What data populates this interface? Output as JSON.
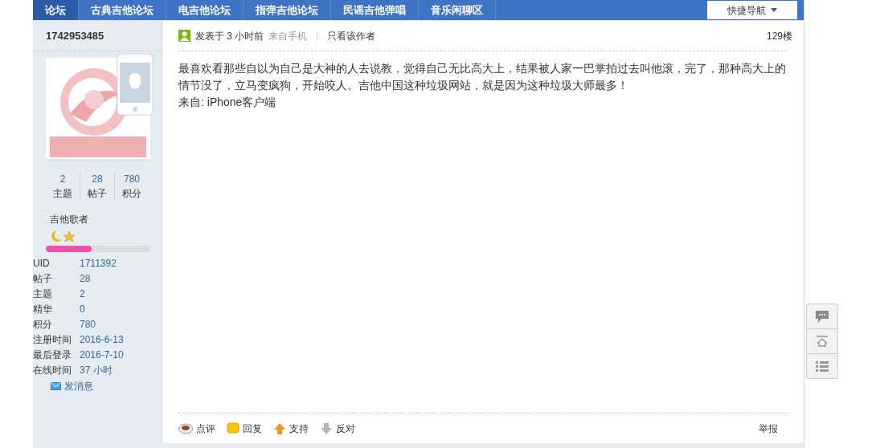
{
  "nav": {
    "tabs": [
      {
        "label": "论坛",
        "selected": true
      },
      {
        "label": "古典吉他论坛",
        "selected": false
      },
      {
        "label": "电吉他论坛",
        "selected": false
      },
      {
        "label": "指弹吉他论坛",
        "selected": false
      },
      {
        "label": "民谣吉他弹唱",
        "selected": false
      },
      {
        "label": "音乐闲聊区",
        "selected": false
      }
    ],
    "quick_nav": "快捷导航"
  },
  "author": {
    "name": "1742953485",
    "stats": [
      {
        "value": "2",
        "label": "主题"
      },
      {
        "value": "28",
        "label": "帖子"
      },
      {
        "value": "780",
        "label": "积分"
      }
    ],
    "rank": "吉他歌者",
    "level": 0.44,
    "profile": [
      {
        "label": "UID",
        "value": "1711392"
      },
      {
        "label": "帖子",
        "value": "28"
      },
      {
        "label": "主题",
        "value": "2"
      },
      {
        "label": "精华",
        "value": "0"
      },
      {
        "label": "积分",
        "value": "780"
      },
      {
        "label": "注册时间",
        "value": "2016-6-13"
      },
      {
        "label": "最后登录",
        "value": "2016-7-10"
      },
      {
        "label": "在线时间",
        "value": "37 小时"
      }
    ],
    "message": "发消息"
  },
  "post": {
    "posted": "发表于 3 小时前",
    "source": "来自手机",
    "only_author": "只看该作者",
    "floor": "129楼",
    "body": [
      "最喜欢看那些自以为自己是大神的人去说教，觉得自己无比高大上，结果被人家一巴掌拍过去叫他滚，完了，那种高大上的情节没了，立马变疯狗，开始咬人。吉他中国这种垃圾网站，就是因为这种垃圾大师最多！",
      "来自: iPhone客户端"
    ],
    "actions": [
      {
        "kind": "comment",
        "label": "点评"
      },
      {
        "kind": "reply",
        "label": "回复"
      },
      {
        "kind": "support",
        "label": "支持"
      },
      {
        "kind": "oppose",
        "label": "反对"
      }
    ],
    "report": "举报"
  }
}
